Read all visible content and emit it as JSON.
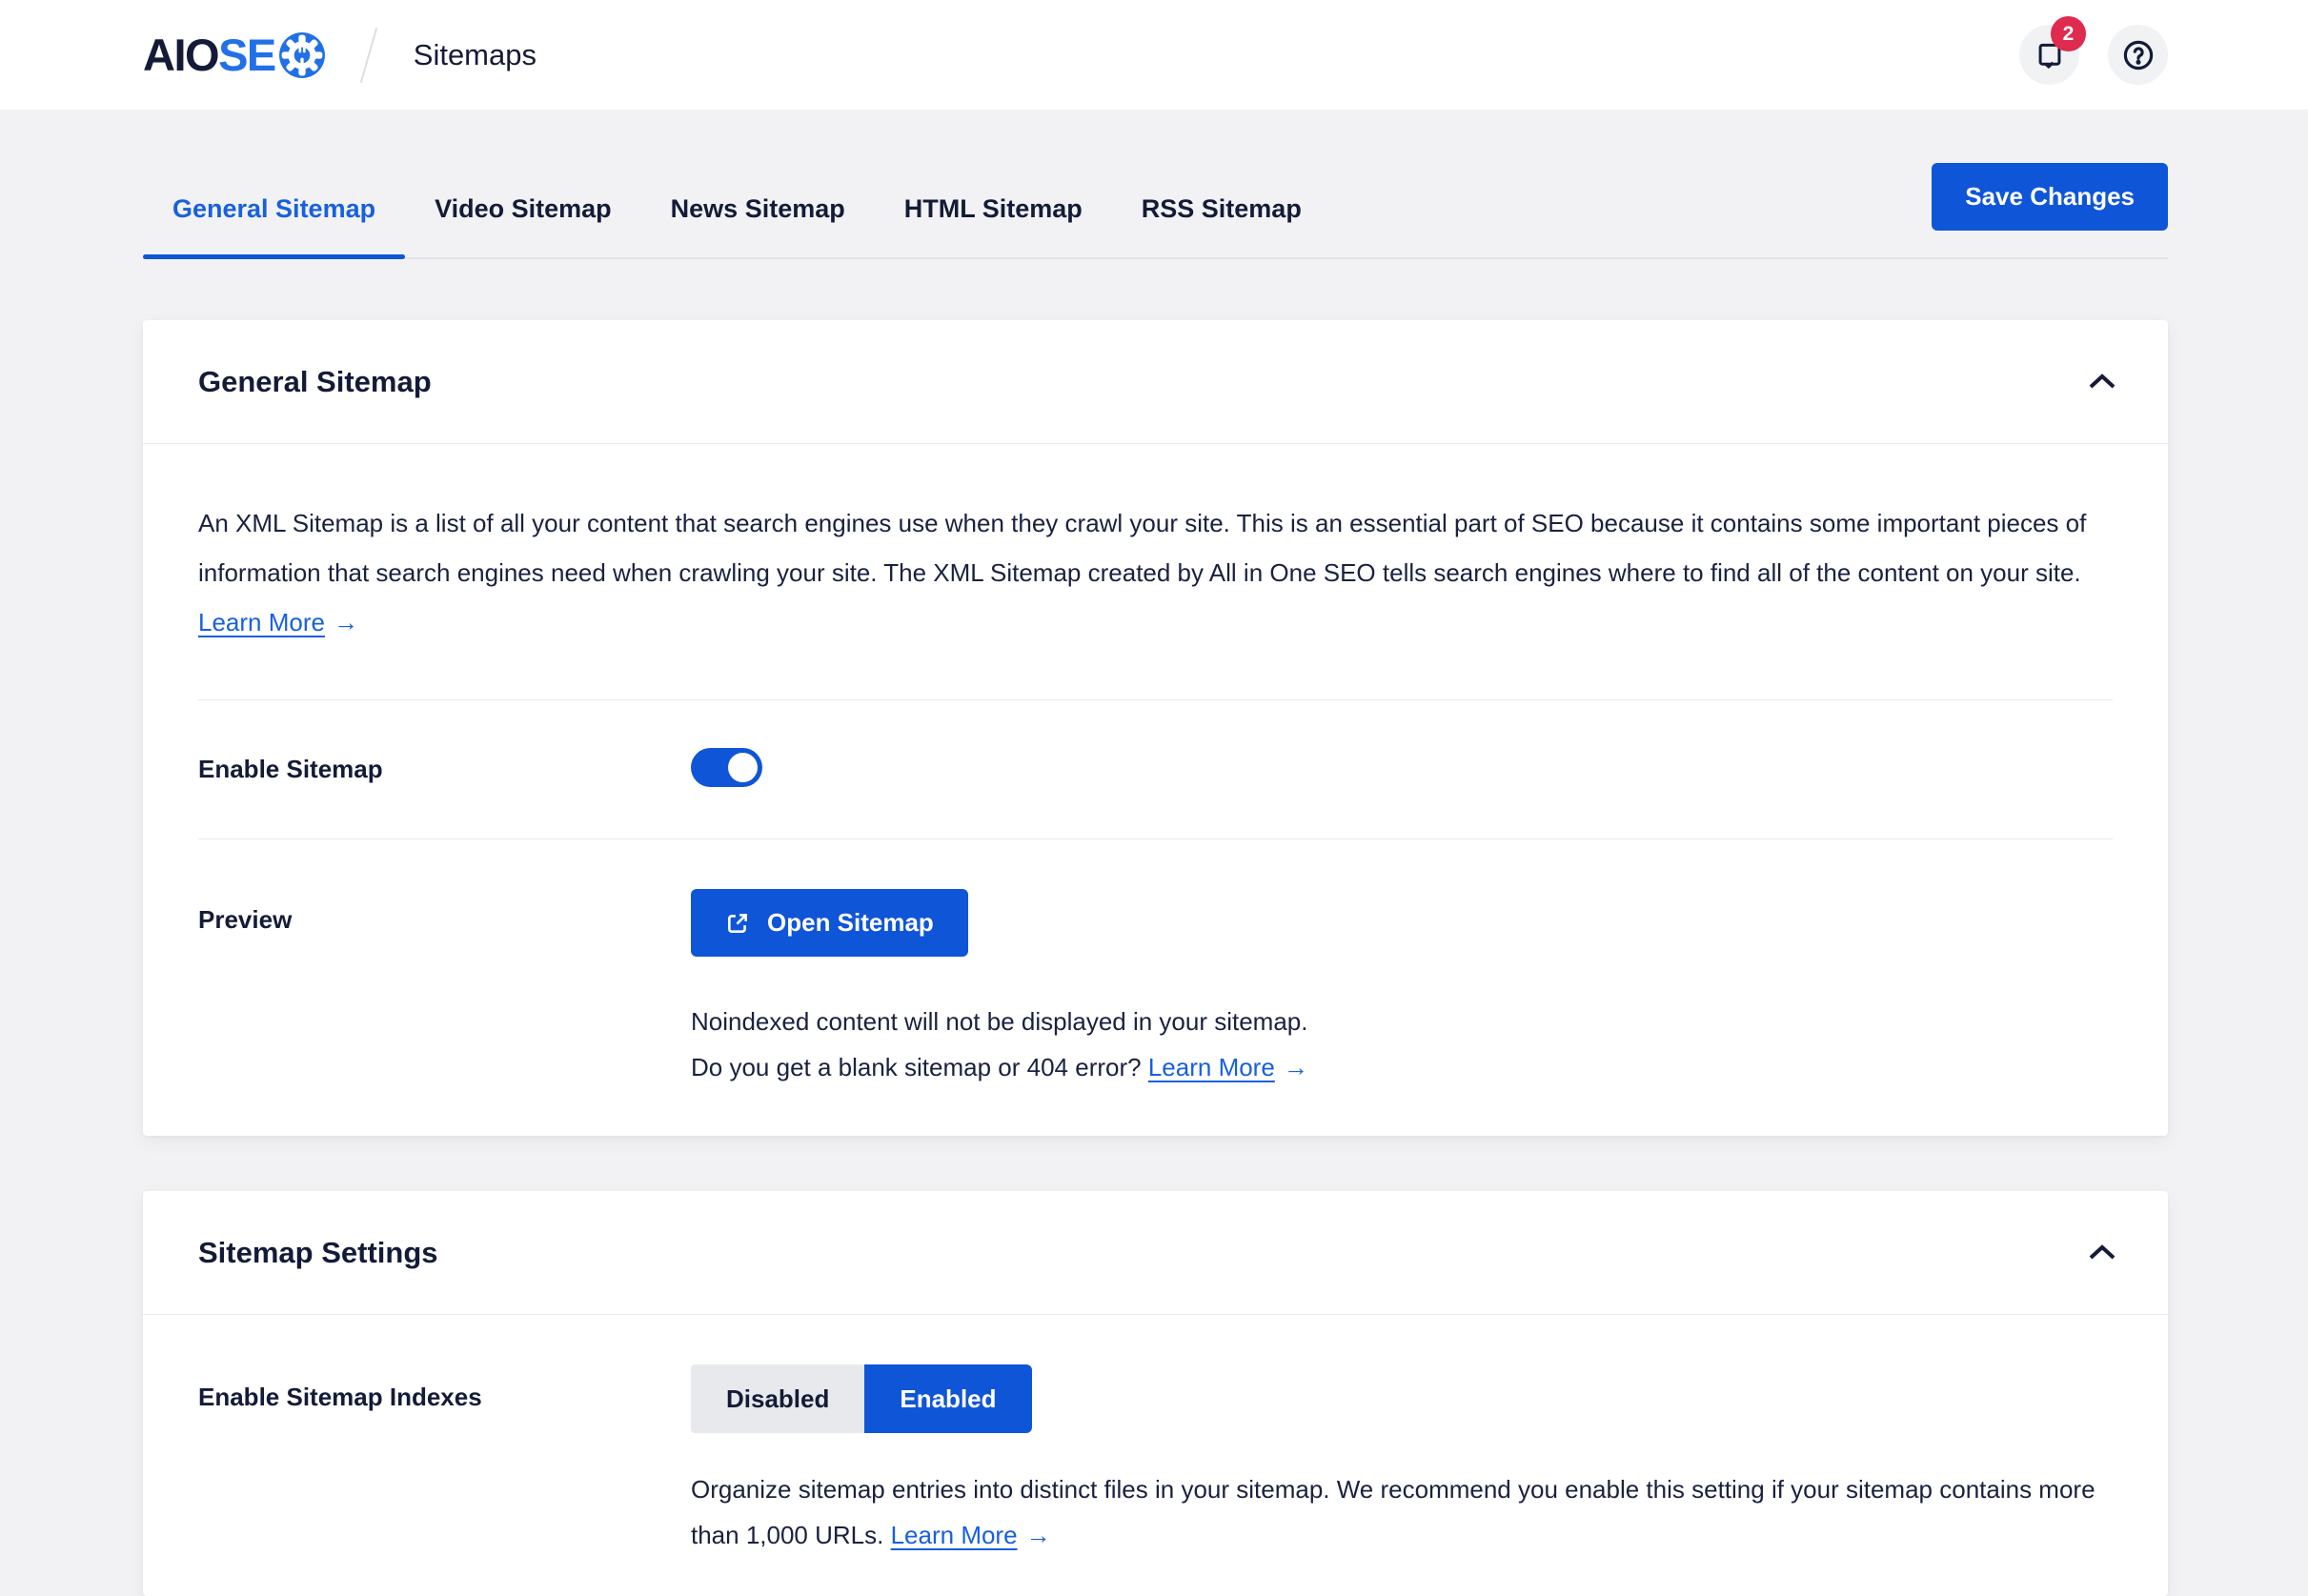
{
  "header": {
    "logo": {
      "part1": "AIO",
      "part2": "SE"
    },
    "page_title": "Sitemaps",
    "notifications_badge": "2"
  },
  "icons": {
    "arrow_right": "→",
    "help_glyph": "?"
  },
  "colors": {
    "accent_blue": "#0F55D8",
    "link_blue": "#1760DF",
    "navy": "#141B38",
    "badge_red": "#DF2B4E",
    "logo_blue": "#2270E7",
    "page_bg": "#F2F2F4"
  },
  "tabs": [
    {
      "label": "General Sitemap",
      "active": true
    },
    {
      "label": "Video Sitemap",
      "active": false
    },
    {
      "label": "News Sitemap",
      "active": false
    },
    {
      "label": "HTML Sitemap",
      "active": false
    },
    {
      "label": "RSS Sitemap",
      "active": false
    }
  ],
  "save_button": "Save Changes",
  "general_card": {
    "title": "General Sitemap",
    "description": "An XML Sitemap is a list of all your content that search engines use when they crawl your site. This is an essential part of SEO because it contains some important pieces of information that search engines need when crawling your site. The XML Sitemap created by All in One SEO tells search engines where to find all of the content on your site.",
    "learn_more": "Learn More",
    "rows": {
      "enable_sitemap": {
        "label": "Enable Sitemap",
        "state": "on"
      },
      "preview": {
        "label": "Preview",
        "open_button": "Open Sitemap",
        "note1": "Noindexed content will not be displayed in your sitemap.",
        "note2": "Do you get a blank sitemap or 404 error?",
        "learn_more": "Learn More"
      }
    }
  },
  "settings_card": {
    "title": "Sitemap Settings",
    "rows": {
      "indexes": {
        "label": "Enable Sitemap Indexes",
        "disabled_option": "Disabled",
        "enabled_option": "Enabled",
        "selected": "Enabled",
        "description": "Organize sitemap entries into distinct files in your sitemap. We recommend you enable this setting if your sitemap contains more than 1,000 URLs.",
        "learn_more": "Learn More"
      }
    }
  }
}
